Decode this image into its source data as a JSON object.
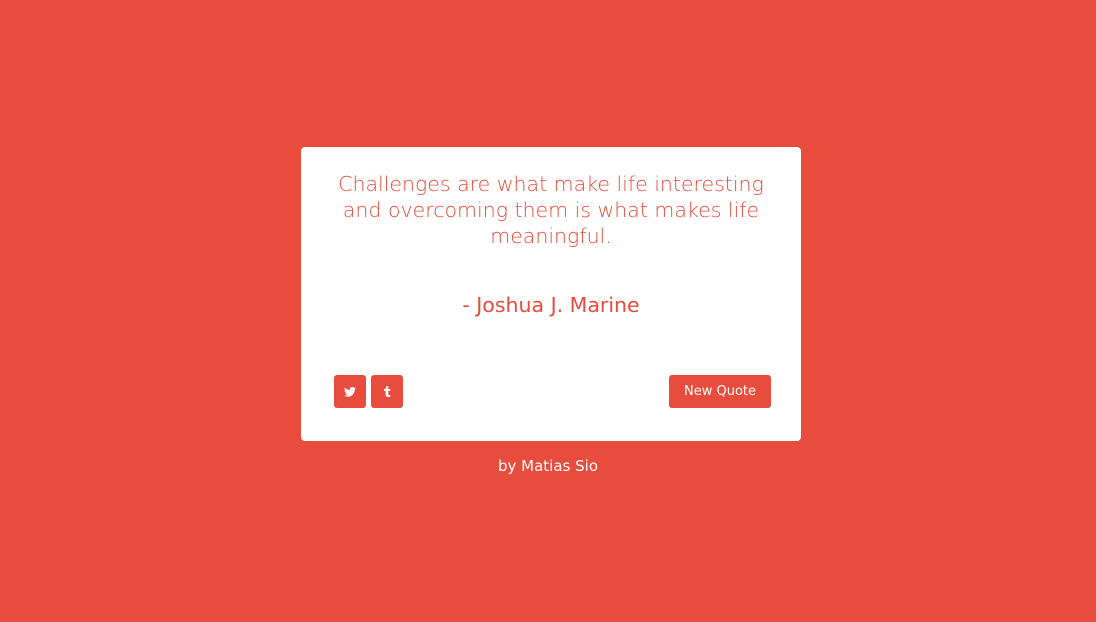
{
  "colors": {
    "background": "#e74c3c",
    "card": "#ffffff",
    "accent": "#e74c3c"
  },
  "quote": {
    "text": "Challenges are what make life interesting and overcoming them is what makes life meaningful.",
    "author": "- Joshua J. Marine"
  },
  "actions": {
    "share_icons": [
      "twitter-icon",
      "tumblr-icon"
    ],
    "new_quote_label": "New Quote"
  },
  "footer": {
    "credit": "by Matias Sio"
  }
}
